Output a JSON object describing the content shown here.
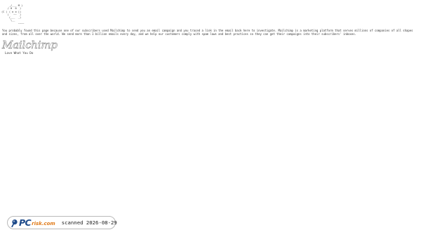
{
  "ascii_art": {
    "lines": [
      "     _/___ M )",
      "    / 0  0  )",
      "(C ( ( o o ))",
      "    (   ~~  )",
      "     (___  _)",
      "      \\__",
      "           ~~~~"
    ]
  },
  "explanation": {
    "text": "You probably found this page because one of our subscribers used Mailchimp to send you an email campaign and you traced a link in the email back here to investigate. Mailchimp is a marketing platform that serves millions of companies of all shapes and sizes, from all over the world. We send more than 1 billion emails every day, and we help our customers comply with spam laws and best practices so they can get their campaigns into their subscribers' inboxes."
  },
  "brand": {
    "wordmark": "Mailchimp",
    "tagline": "Love What You Do"
  },
  "badge": {
    "logo_pc": "PC",
    "logo_risk": "risk.com",
    "scan_text": "scanned 2026-08-29",
    "colors": {
      "pc": "#1d4a8a",
      "risk": "#e07b1a",
      "border": "#b9b9b9"
    }
  }
}
